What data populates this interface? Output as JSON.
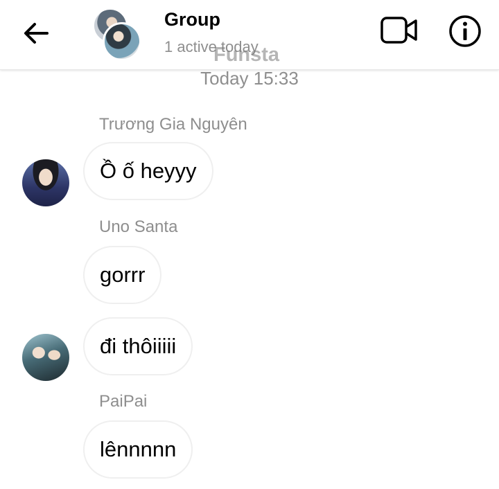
{
  "header": {
    "title": "Group",
    "status": "1 active today",
    "watermark": "Funsta",
    "icons": {
      "back": "arrow-left-icon",
      "video": "video-camera-icon",
      "info": "info-icon"
    }
  },
  "timestamp": "Today 15:33",
  "messages": [
    {
      "sender": "Trương Gia Nguyên",
      "text": "Ồ ố heyyy"
    },
    {
      "sender": "Uno Santa",
      "text": "gorrr"
    },
    {
      "sender": "",
      "text": "đi thôiiiii"
    },
    {
      "sender": "PaiPai",
      "text": "lênnnnn"
    }
  ]
}
